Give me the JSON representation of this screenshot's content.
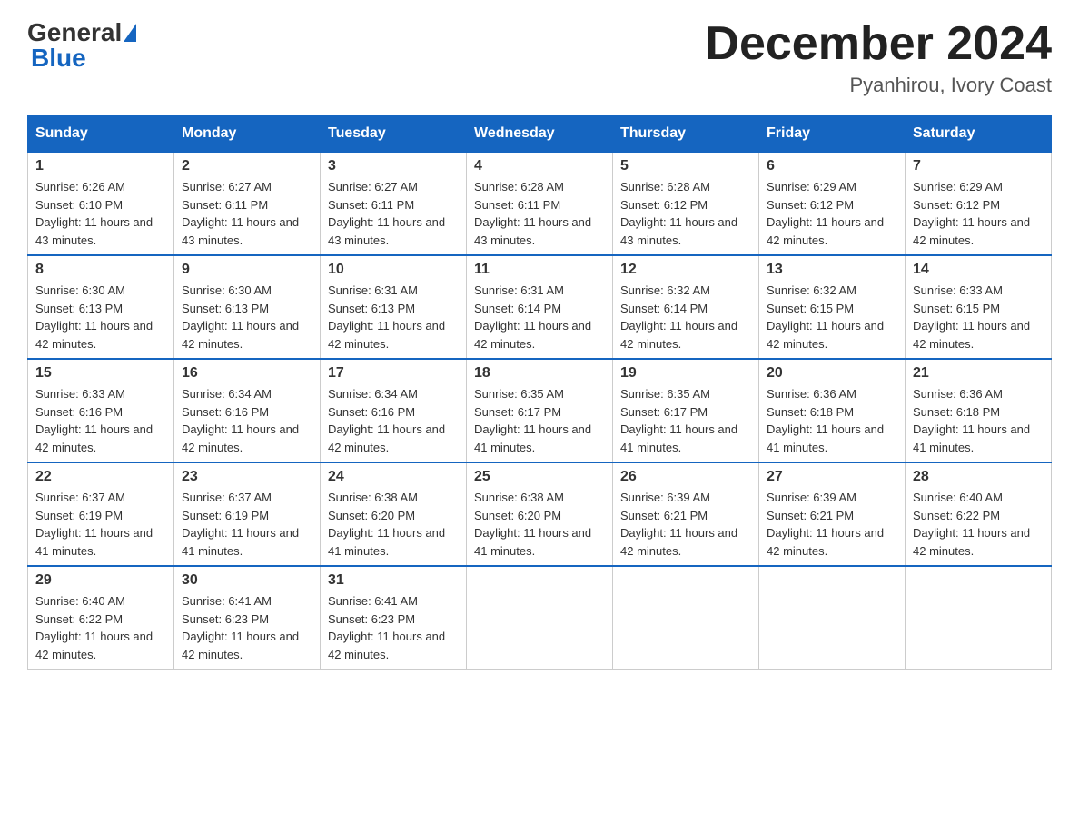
{
  "header": {
    "logo_general": "General",
    "logo_blue": "Blue",
    "month_title": "December 2024",
    "location": "Pyanhirou, Ivory Coast"
  },
  "days_of_week": [
    "Sunday",
    "Monday",
    "Tuesday",
    "Wednesday",
    "Thursday",
    "Friday",
    "Saturday"
  ],
  "weeks": [
    [
      {
        "day": "1",
        "sunrise": "6:26 AM",
        "sunset": "6:10 PM",
        "daylight": "11 hours and 43 minutes."
      },
      {
        "day": "2",
        "sunrise": "6:27 AM",
        "sunset": "6:11 PM",
        "daylight": "11 hours and 43 minutes."
      },
      {
        "day": "3",
        "sunrise": "6:27 AM",
        "sunset": "6:11 PM",
        "daylight": "11 hours and 43 minutes."
      },
      {
        "day": "4",
        "sunrise": "6:28 AM",
        "sunset": "6:11 PM",
        "daylight": "11 hours and 43 minutes."
      },
      {
        "day": "5",
        "sunrise": "6:28 AM",
        "sunset": "6:12 PM",
        "daylight": "11 hours and 43 minutes."
      },
      {
        "day": "6",
        "sunrise": "6:29 AM",
        "sunset": "6:12 PM",
        "daylight": "11 hours and 42 minutes."
      },
      {
        "day": "7",
        "sunrise": "6:29 AM",
        "sunset": "6:12 PM",
        "daylight": "11 hours and 42 minutes."
      }
    ],
    [
      {
        "day": "8",
        "sunrise": "6:30 AM",
        "sunset": "6:13 PM",
        "daylight": "11 hours and 42 minutes."
      },
      {
        "day": "9",
        "sunrise": "6:30 AM",
        "sunset": "6:13 PM",
        "daylight": "11 hours and 42 minutes."
      },
      {
        "day": "10",
        "sunrise": "6:31 AM",
        "sunset": "6:13 PM",
        "daylight": "11 hours and 42 minutes."
      },
      {
        "day": "11",
        "sunrise": "6:31 AM",
        "sunset": "6:14 PM",
        "daylight": "11 hours and 42 minutes."
      },
      {
        "day": "12",
        "sunrise": "6:32 AM",
        "sunset": "6:14 PM",
        "daylight": "11 hours and 42 minutes."
      },
      {
        "day": "13",
        "sunrise": "6:32 AM",
        "sunset": "6:15 PM",
        "daylight": "11 hours and 42 minutes."
      },
      {
        "day": "14",
        "sunrise": "6:33 AM",
        "sunset": "6:15 PM",
        "daylight": "11 hours and 42 minutes."
      }
    ],
    [
      {
        "day": "15",
        "sunrise": "6:33 AM",
        "sunset": "6:16 PM",
        "daylight": "11 hours and 42 minutes."
      },
      {
        "day": "16",
        "sunrise": "6:34 AM",
        "sunset": "6:16 PM",
        "daylight": "11 hours and 42 minutes."
      },
      {
        "day": "17",
        "sunrise": "6:34 AM",
        "sunset": "6:16 PM",
        "daylight": "11 hours and 42 minutes."
      },
      {
        "day": "18",
        "sunrise": "6:35 AM",
        "sunset": "6:17 PM",
        "daylight": "11 hours and 41 minutes."
      },
      {
        "day": "19",
        "sunrise": "6:35 AM",
        "sunset": "6:17 PM",
        "daylight": "11 hours and 41 minutes."
      },
      {
        "day": "20",
        "sunrise": "6:36 AM",
        "sunset": "6:18 PM",
        "daylight": "11 hours and 41 minutes."
      },
      {
        "day": "21",
        "sunrise": "6:36 AM",
        "sunset": "6:18 PM",
        "daylight": "11 hours and 41 minutes."
      }
    ],
    [
      {
        "day": "22",
        "sunrise": "6:37 AM",
        "sunset": "6:19 PM",
        "daylight": "11 hours and 41 minutes."
      },
      {
        "day": "23",
        "sunrise": "6:37 AM",
        "sunset": "6:19 PM",
        "daylight": "11 hours and 41 minutes."
      },
      {
        "day": "24",
        "sunrise": "6:38 AM",
        "sunset": "6:20 PM",
        "daylight": "11 hours and 41 minutes."
      },
      {
        "day": "25",
        "sunrise": "6:38 AM",
        "sunset": "6:20 PM",
        "daylight": "11 hours and 41 minutes."
      },
      {
        "day": "26",
        "sunrise": "6:39 AM",
        "sunset": "6:21 PM",
        "daylight": "11 hours and 42 minutes."
      },
      {
        "day": "27",
        "sunrise": "6:39 AM",
        "sunset": "6:21 PM",
        "daylight": "11 hours and 42 minutes."
      },
      {
        "day": "28",
        "sunrise": "6:40 AM",
        "sunset": "6:22 PM",
        "daylight": "11 hours and 42 minutes."
      }
    ],
    [
      {
        "day": "29",
        "sunrise": "6:40 AM",
        "sunset": "6:22 PM",
        "daylight": "11 hours and 42 minutes."
      },
      {
        "day": "30",
        "sunrise": "6:41 AM",
        "sunset": "6:23 PM",
        "daylight": "11 hours and 42 minutes."
      },
      {
        "day": "31",
        "sunrise": "6:41 AM",
        "sunset": "6:23 PM",
        "daylight": "11 hours and 42 minutes."
      },
      null,
      null,
      null,
      null
    ]
  ]
}
